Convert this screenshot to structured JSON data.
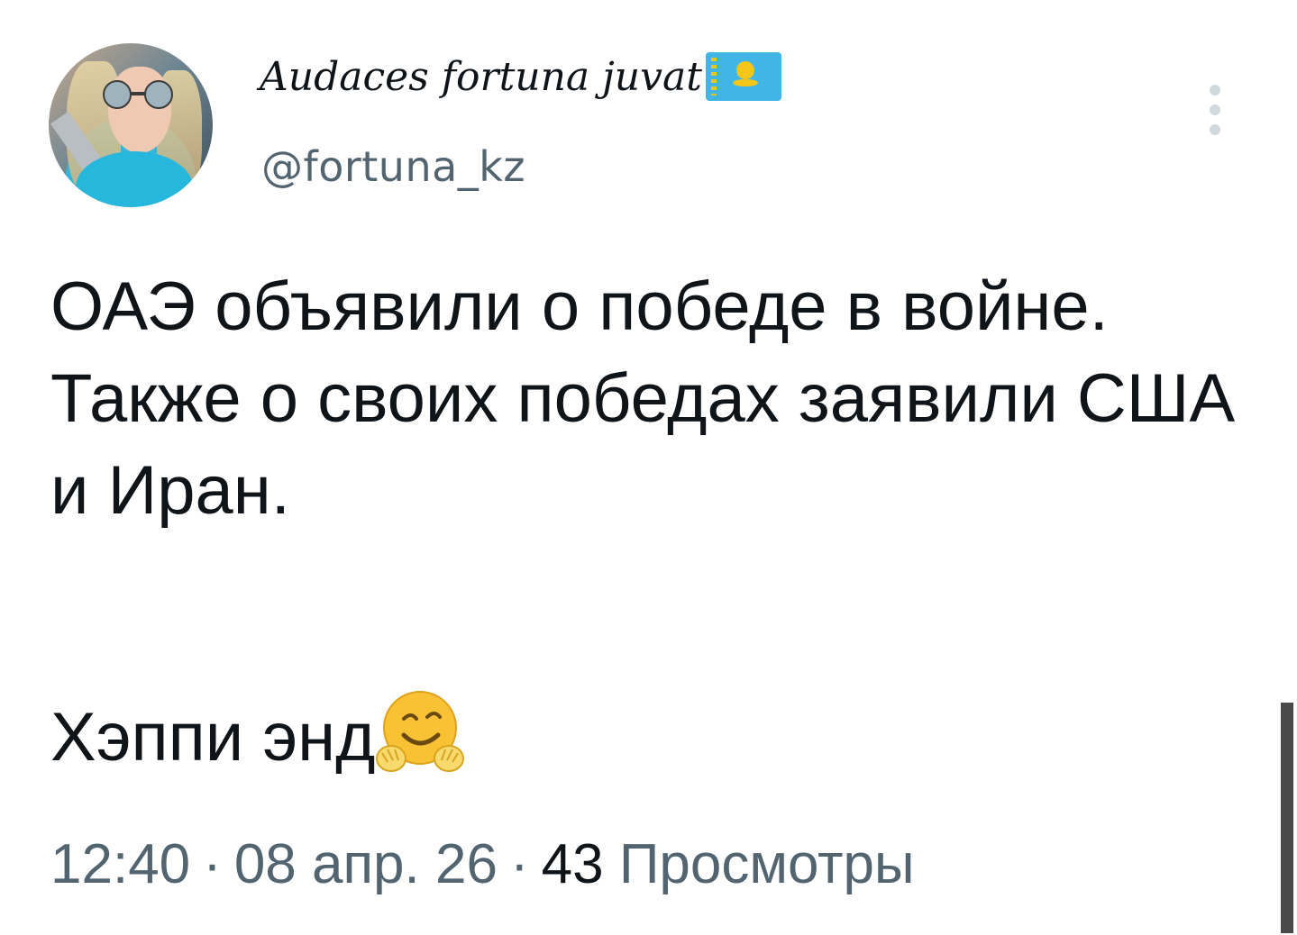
{
  "author": {
    "display_name": "Audaces fortuna juvat",
    "handle": "@fortuna_kz",
    "flag_icon": "kazakhstan-flag-icon"
  },
  "tweet": {
    "text": "ОАЭ объявили о победе в войне. Также о своих победах заявили США и Иран.",
    "line2": "Хэппи энд",
    "emoji": "hugging-face-emoji"
  },
  "meta": {
    "time": "12:40",
    "separator": "·",
    "date": "08 апр. 26",
    "views_count": "43",
    "views_label": "Просмотры"
  },
  "colors": {
    "text_primary": "#0f1419",
    "text_secondary": "#536471",
    "flag_blue": "#41b6e6",
    "flag_gold": "#f5c518"
  }
}
